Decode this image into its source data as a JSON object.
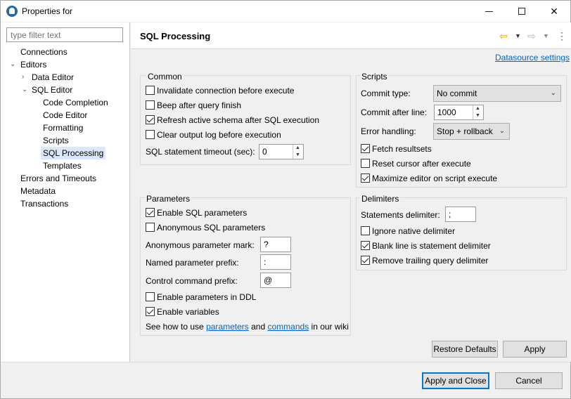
{
  "window": {
    "title": "Properties for",
    "controls": [
      "minimize",
      "maximize",
      "close"
    ]
  },
  "sidebar": {
    "filter_placeholder": "type filter text",
    "items": [
      {
        "label": "Connections"
      },
      {
        "label": "Editors"
      },
      {
        "label": "Data Editor"
      },
      {
        "label": "SQL Editor"
      },
      {
        "label": "Code Completion"
      },
      {
        "label": "Code Editor"
      },
      {
        "label": "Formatting"
      },
      {
        "label": "Scripts"
      },
      {
        "label": "SQL Processing",
        "selected": true
      },
      {
        "label": "Templates"
      },
      {
        "label": "Errors and Timeouts"
      },
      {
        "label": "Metadata"
      },
      {
        "label": "Transactions"
      }
    ]
  },
  "header": {
    "title": "SQL Processing",
    "datasource_link": "Datasource settings"
  },
  "common": {
    "title": "Common",
    "invalidate": {
      "label": "Invalidate connection before execute",
      "checked": false
    },
    "beep": {
      "label": "Beep after query finish",
      "checked": false
    },
    "refresh": {
      "label": "Refresh active schema after SQL execution",
      "checked": true
    },
    "clear_log": {
      "label": "Clear output log before execution",
      "checked": false
    },
    "timeout_label": "SQL statement timeout (sec):",
    "timeout_value": "0"
  },
  "scripts": {
    "title": "Scripts",
    "commit_type_label": "Commit type:",
    "commit_type_value": "No commit",
    "commit_after_label": "Commit after line:",
    "commit_after_value": "1000",
    "error_handling_label": "Error handling:",
    "error_handling_value": "Stop + rollback",
    "fetch": {
      "label": "Fetch resultsets",
      "checked": true
    },
    "reset_cursor": {
      "label": "Reset cursor after execute",
      "checked": false
    },
    "maximize": {
      "label": "Maximize editor on script execute",
      "checked": true
    }
  },
  "parameters": {
    "title": "Parameters",
    "enable_sql": {
      "label": "Enable SQL parameters",
      "checked": true
    },
    "anonymous": {
      "label": "Anonymous SQL parameters",
      "checked": false
    },
    "anon_mark_label": "Anonymous parameter mark:",
    "anon_mark_value": "?",
    "named_prefix_label": "Named parameter prefix:",
    "named_prefix_value": ":",
    "control_prefix_label": "Control command prefix:",
    "control_prefix_value": "@",
    "ddl": {
      "label": "Enable parameters in DDL",
      "checked": false
    },
    "variables": {
      "label": "Enable variables",
      "checked": true
    },
    "help_prefix": "See how to use",
    "help_link1": "parameters",
    "help_and": "and",
    "help_link2": "commands",
    "help_suffix": "in our wiki"
  },
  "delimiters": {
    "title": "Delimiters",
    "stmt_label": "Statements delimiter:",
    "stmt_value": ";",
    "ignore_native": {
      "label": "Ignore native delimiter",
      "checked": false
    },
    "blank_line": {
      "label": "Blank line is statement delimiter",
      "checked": true
    },
    "remove_trailing": {
      "label": "Remove trailing query delimiter",
      "checked": true
    }
  },
  "buttons": {
    "restore_defaults": "Restore Defaults",
    "apply": "Apply",
    "apply_close": "Apply and Close",
    "cancel": "Cancel"
  },
  "colors": {
    "link": "#0066cc",
    "selection": "#d9e8fb",
    "nav_arrow": "#e8a200"
  }
}
